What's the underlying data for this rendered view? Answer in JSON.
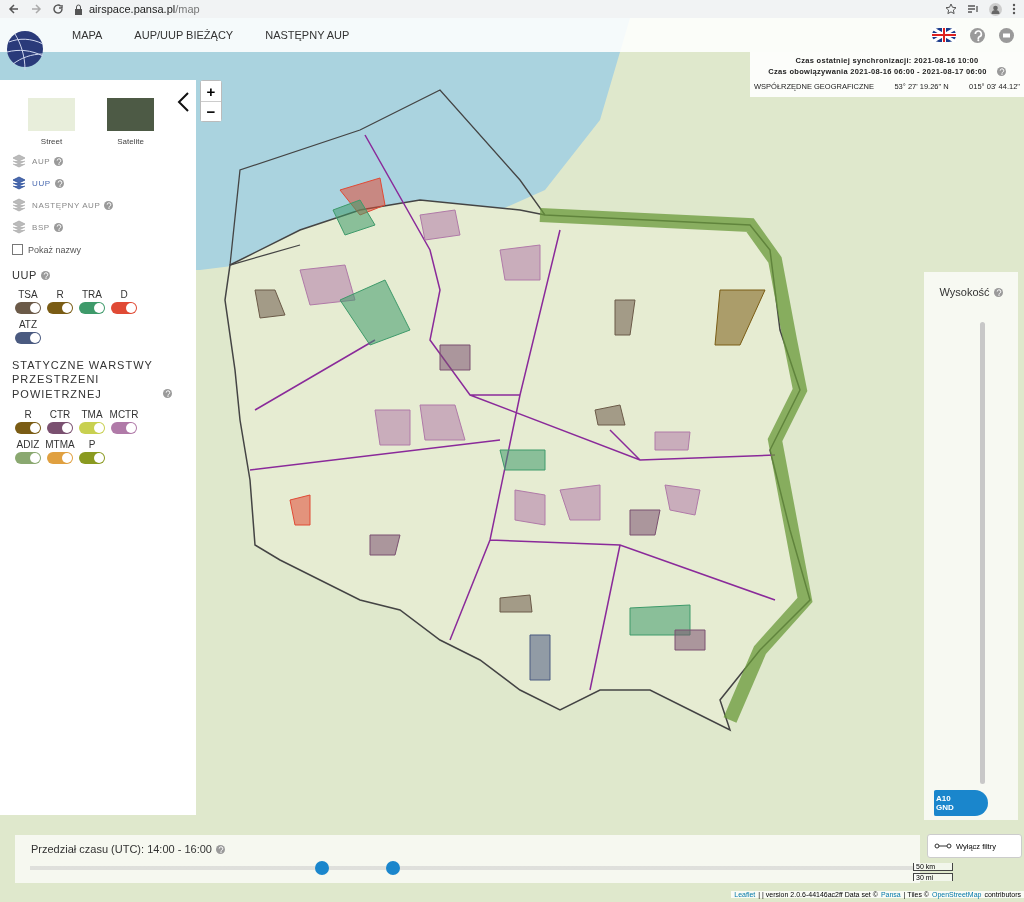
{
  "browser": {
    "host": "airspace.pansa.pl",
    "path": "/map"
  },
  "nav": {
    "items": [
      {
        "label": "MAPA"
      },
      {
        "label": "AUP/UUP BIEŻĄCY"
      },
      {
        "label": "NASTĘPNY AUP"
      }
    ]
  },
  "base_maps": [
    {
      "label": "Street",
      "kind": "street"
    },
    {
      "label": "Satelite",
      "kind": "satellite"
    }
  ],
  "layers": [
    {
      "label": "AUP",
      "selected": false
    },
    {
      "label": "UUP",
      "selected": true
    },
    {
      "label": "NASTĘPNY AUP",
      "selected": false
    },
    {
      "label": "BSP",
      "selected": false
    }
  ],
  "show_names": {
    "label": "Pokaż nazwy",
    "checked": false
  },
  "uup": {
    "title": "UUP",
    "toggles": [
      {
        "label": "TSA",
        "color": "#6b5a48",
        "on": true
      },
      {
        "label": "R",
        "color": "#7a5c14",
        "on": true
      },
      {
        "label": "TRA",
        "color": "#3e9a6a",
        "on": true
      },
      {
        "label": "D",
        "color": "#e04a35",
        "on": true
      },
      {
        "label": "ATZ",
        "color": "#4a5a80",
        "on": true
      }
    ]
  },
  "static_layers": {
    "title": "STATYCZNE WARSTWY PRZESTRZENI POWIETRZNEJ",
    "toggles": [
      {
        "label": "R",
        "color": "#7a5c14",
        "on": true
      },
      {
        "label": "CTR",
        "color": "#7a5070",
        "on": true
      },
      {
        "label": "TMA",
        "color": "#c8d050",
        "on": true
      },
      {
        "label": "MCTR",
        "color": "#b07aa8",
        "on": true
      },
      {
        "label": "ADIZ",
        "color": "#8aa870",
        "on": true
      },
      {
        "label": "MTMA",
        "color": "#e0a040",
        "on": true
      },
      {
        "label": "P",
        "color": "#8a9a20",
        "on": true
      }
    ]
  },
  "info": {
    "sync": "Czas ostatniej synchronizacji: 2021-08-16 10:00",
    "validity": "Czas obowiązywania 2021-08-16 06:00 - 2021-08-17 06:00",
    "coords_label": "WSPÓŁRZĘDNE GEOGRAFICZNE",
    "lat": "53° 27' 19.26\" N",
    "lon": "015° 03' 44.12\""
  },
  "zoom": {
    "in": "+",
    "out": "−"
  },
  "altitude": {
    "title": "Wysokość",
    "upper": "A10",
    "lower": "GND"
  },
  "time_range": {
    "label": "Przedział czasu (UTC): 14:00 - 16:00",
    "start": {
      "level": 0.33
    },
    "end": {
      "level": 0.41
    }
  },
  "filter_button": "Wyłącz filtry",
  "scale": {
    "metric": "50 km",
    "imperial": "30 mi"
  },
  "attribution": {
    "leaflet": "Leaflet",
    "version": "| | version 2.0.6-44146ac2ff Data set ©",
    "pansa": "Pansa",
    "tiles": "| Tiles ©",
    "osm": "OpenStreetMap",
    "contributors": "contributors"
  }
}
